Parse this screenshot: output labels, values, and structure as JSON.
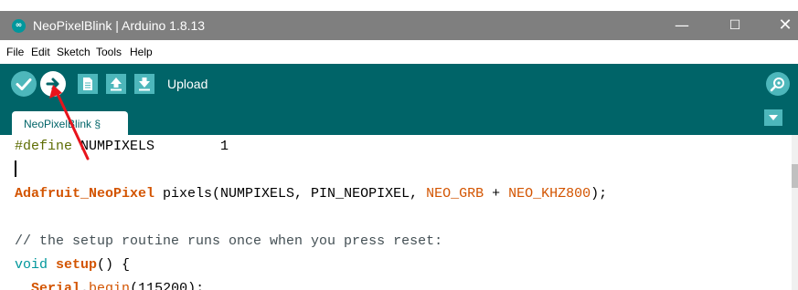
{
  "window": {
    "title": "NeoPixelBlink | Arduino 1.8.13",
    "logo_icon": "arduino-infinity-icon",
    "minimize_glyph": "—",
    "maximize_glyph": "☐",
    "close_glyph": "✕"
  },
  "menu": [
    "File",
    "Edit",
    "Sketch",
    "Tools",
    "Help"
  ],
  "toolbar": {
    "hover_label": "Upload",
    "buttons": [
      "verify-icon",
      "upload-icon",
      "new-icon",
      "open-icon",
      "save-icon"
    ],
    "serial_monitor_icon": "magnifier-icon",
    "background": "#006468",
    "button_color": "#4db7bb"
  },
  "tabs": [
    {
      "label": "NeoPixelBlink §",
      "selected": true
    }
  ],
  "editor": {
    "lines": [
      [
        {
          "t": "#define",
          "c": "kw-define"
        },
        {
          "t": " NUMPIXELS        1",
          "c": ""
        }
      ],
      [],
      [
        {
          "t": "Adafruit_NeoPixel",
          "c": "kw-type"
        },
        {
          "t": " pixels(NUMPIXELS, PIN_NEOPIXEL, ",
          "c": ""
        },
        {
          "t": "NEO_GRB",
          "c": "kw-const"
        },
        {
          "t": " + ",
          "c": ""
        },
        {
          "t": "NEO_KHZ800",
          "c": "kw-const"
        },
        {
          "t": ");",
          "c": ""
        }
      ],
      [],
      [
        {
          "t": "// the setup routine runs once when you press reset:",
          "c": "kw-comment"
        }
      ],
      [
        {
          "t": "void",
          "c": "kw-void"
        },
        {
          "t": " ",
          "c": ""
        },
        {
          "t": "setup",
          "c": "kw-fn"
        },
        {
          "t": "() {",
          "c": ""
        }
      ],
      [
        {
          "t": "  ",
          "c": ""
        },
        {
          "t": "Serial",
          "c": "kw-fn"
        },
        {
          "t": ".",
          "c": ""
        },
        {
          "t": "begin",
          "c": "kw-const"
        },
        {
          "t": "(115200);",
          "c": ""
        }
      ]
    ]
  },
  "annotation": {
    "type": "arrow",
    "target": "upload-button",
    "color": "#e8141c"
  }
}
